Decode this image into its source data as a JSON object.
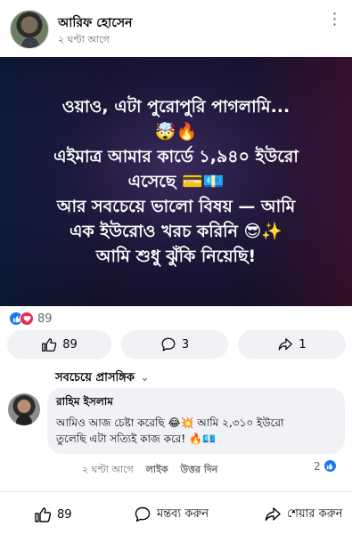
{
  "post": {
    "author": "আরিফ হোসেন",
    "time": "২ ঘণ্টা আগে",
    "more_icon": "more-horizontal-icon"
  },
  "banner": {
    "lines": [
      "ওয়াও, এটা পুরোপুরি পাগলামি...",
      "🤯🔥",
      "এইমাত্র আমার কার্ডে ১,৯৪০ ইউরো",
      "এসেছে 💳💶",
      "আর সবচেয়ে ভালো বিষয় — আমি",
      "এক ইউরোও খরচ করিনি 😎✨",
      "আমি শুধু ঝুঁকি নিয়েছি!"
    ]
  },
  "reactions": {
    "count": "89",
    "icons": [
      "like-icon",
      "love-icon"
    ]
  },
  "actions": {
    "like_count": "89",
    "comment_count": "3",
    "share_count": "1"
  },
  "comments_section": {
    "sort_label": "সবচেয়ে প্রাসঙ্গিক"
  },
  "comment": {
    "author": "রাহিম ইসলাম",
    "text_lines": [
      "আমিও আজ চেষ্টা করেছি 😂💥 আমি ২,৩১০ ইউরো",
      "তুলেছি এটা সত্যিই কাজ করে! 🔥💶"
    ],
    "time": "২ ঘণ্টা আগে",
    "like_label": "লাইক",
    "reply_label": "উত্তর দিন",
    "reaction_count": "2"
  },
  "bottom_bar": {
    "like_count": "89",
    "comment_label": "মন্তব্য করুন",
    "share_label": "শেয়ার করুন"
  },
  "colors": {
    "accent": "#1877f2",
    "love": "#f0284a",
    "secondary_text": "#65676b",
    "button_bg": "#f0f2f5"
  }
}
